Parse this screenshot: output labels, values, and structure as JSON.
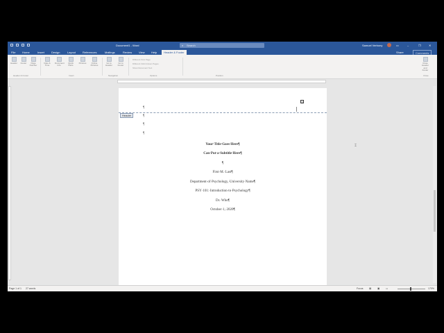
{
  "window": {
    "doc_title": "Document1 - Word",
    "search_placeholder": "Search",
    "user_name": "Samuel Verbony",
    "controls": {
      "minimize": "–",
      "restore": "❐",
      "close": "✕"
    }
  },
  "tabs": [
    "File",
    "Home",
    "Insert",
    "Design",
    "Layout",
    "References",
    "Mailings",
    "Review",
    "View",
    "Help",
    "Header & Footer"
  ],
  "active_tab": "Header & Footer",
  "share_label": "Share",
  "comments_label": "Comments",
  "ribbon": {
    "buttons": [
      {
        "label": "Header",
        "icon": "header-icon"
      },
      {
        "label": "Footer",
        "icon": "footer-icon"
      },
      {
        "label": "Page Number",
        "icon": "page-number-icon"
      },
      {
        "label": "Date & Time",
        "icon": "date-time-icon"
      },
      {
        "label": "Document Info",
        "icon": "document-info-icon"
      },
      {
        "label": "Quick Parts",
        "icon": "quick-parts-icon"
      },
      {
        "label": "Pictures",
        "icon": "pictures-icon"
      },
      {
        "label": "Online Pictures",
        "icon": "online-pictures-icon"
      },
      {
        "label": "Go to Header",
        "icon": "go-to-header-icon"
      },
      {
        "label": "Go to Footer",
        "icon": "go-to-footer-icon"
      },
      {
        "label": "Close Header and Footer",
        "icon": "close-header-footer-icon"
      }
    ],
    "options": [
      "Different First Page",
      "Different Odd & Even Pages",
      "Show Document Text"
    ],
    "groups": [
      "Header & Footer",
      "Insert",
      "Navigation",
      "Options",
      "Position",
      "Close"
    ]
  },
  "page": {
    "header_tag": "Header",
    "page_number": "1",
    "pilcrow": "¶",
    "lines": [
      {
        "text": "Your·Title·Goes·Here¶",
        "bold": true
      },
      {
        "text": "Can·Put·a·Subtitle·Here¶",
        "bold": true
      },
      {
        "text": "¶",
        "bold": false
      },
      {
        "text": "First·M.·Last¶",
        "bold": false
      },
      {
        "text": "Department·of·Psychology,·University·Name¶",
        "bold": false
      },
      {
        "text": "PSY·101:·Introduction·to·Psychology¶",
        "bold": false
      },
      {
        "text": "Dr.·Who¶",
        "bold": false
      },
      {
        "text": "October·1,·2020¶",
        "bold": false
      }
    ]
  },
  "status": {
    "page": "Page 1 of 1",
    "words": "27 words",
    "focus": "Focus",
    "zoom": "170%"
  },
  "colors": {
    "word_blue": "#2b579a",
    "ribbon_bg": "#f3f2f1"
  }
}
